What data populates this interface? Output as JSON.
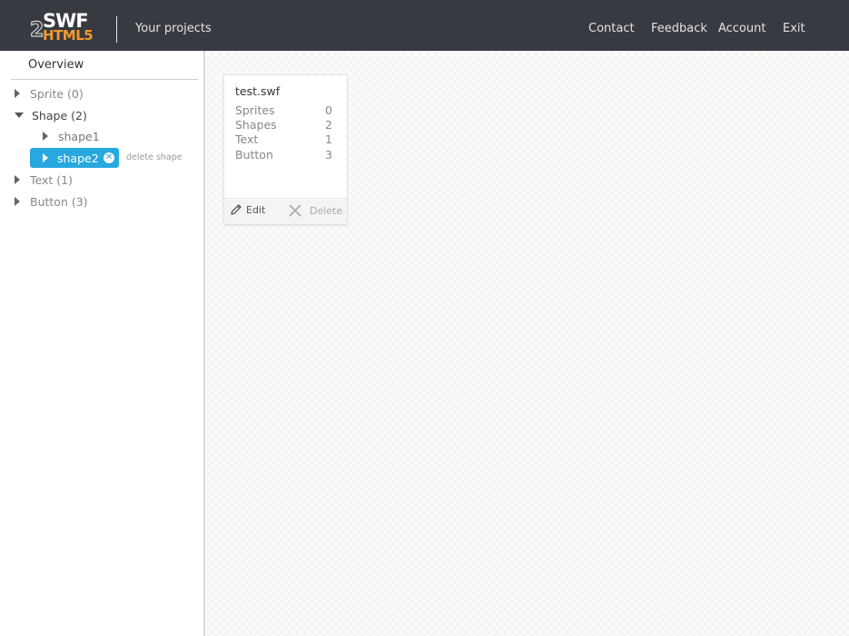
{
  "header": {
    "logo_swf": "SWF",
    "logo_2": "2",
    "logo_html5": "HTML5",
    "title": "Your projects",
    "nav": {
      "contact": "Contact",
      "feedback": "Feedback",
      "account": "Account",
      "exit": "Exit"
    }
  },
  "sidebar": {
    "overview": "Overview",
    "sprite": "Sprite (0)",
    "shape": "Shape (2)",
    "shape1": "shape1",
    "shape2": "shape2",
    "delete_hint": "delete shape",
    "text": "Text (1)",
    "button": "Button (3)"
  },
  "card": {
    "title": "test.swf",
    "stats": [
      {
        "label": "Sprites",
        "value": "0"
      },
      {
        "label": "Shapes",
        "value": "2"
      },
      {
        "label": "Text",
        "value": "1"
      },
      {
        "label": "Button",
        "value": "3"
      }
    ],
    "edit_label": "Edit",
    "delete_label": "Delete"
  },
  "colors": {
    "header_bg": "#383a42",
    "accent": "#27a8de",
    "logo_orange": "#f39b2a"
  }
}
